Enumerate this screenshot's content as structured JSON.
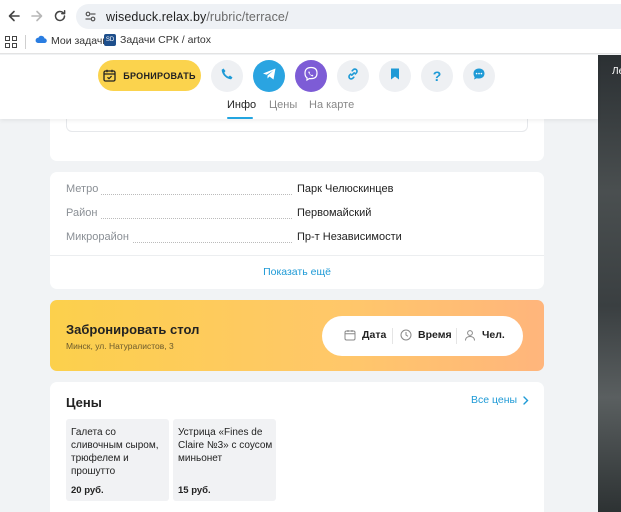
{
  "browser": {
    "url_host": "wiseduck.relax.by",
    "url_path": "/rubric/terrace/",
    "bookmarks": [
      {
        "label": "Мои задачи"
      },
      {
        "label": "Задачи СРК / artox",
        "badge": "SD"
      }
    ]
  },
  "right_panel": {
    "text": "Ле"
  },
  "header": {
    "book_button": "БРОНИРОВАТЬ",
    "tabs": [
      {
        "label": "Инфо",
        "active": true
      },
      {
        "label": "Цены",
        "active": false
      },
      {
        "label": "На карте",
        "active": false
      }
    ],
    "accent_color": "#23a5e0"
  },
  "location": {
    "rows": [
      {
        "label": "Метро",
        "value": "Парк Челюскинцев"
      },
      {
        "label": "Район",
        "value": "Первомайский"
      },
      {
        "label": "Микрорайон",
        "value": "Пр-т Независимости"
      }
    ],
    "show_more": "Показать ещё"
  },
  "booking": {
    "title": "Забронировать стол",
    "address": "Минск, ул. Натуралистов, 3",
    "date_label": "Дата",
    "time_label": "Время",
    "people_label": "Чел."
  },
  "prices": {
    "title": "Цены",
    "all_link": "Все цены",
    "items": [
      {
        "name": "Галета со сливочным сыром, трюфелем и прошутто",
        "price": "20 руб."
      },
      {
        "name": "Устрица «Fines de Claire №3» с соусом миньонет",
        "price": "15 руб."
      }
    ]
  }
}
